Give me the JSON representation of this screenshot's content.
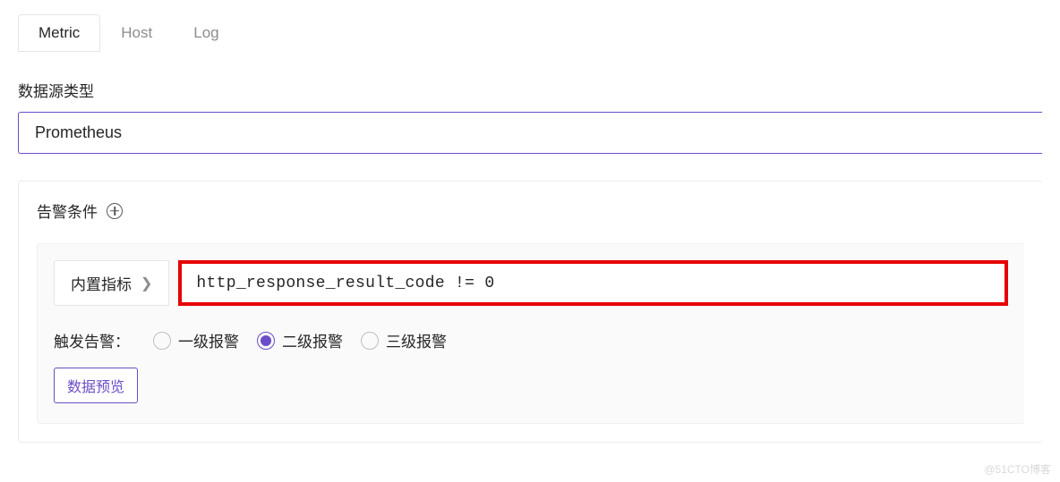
{
  "tabs": {
    "metric": "Metric",
    "host": "Host",
    "log": "Log"
  },
  "datasource": {
    "label": "数据源类型",
    "value": "Prometheus"
  },
  "alertCondition": {
    "title": "告警条件",
    "builtinMetric": {
      "label": "内置指标"
    },
    "expression": "http_response_result_code != 0",
    "trigger": {
      "label": "触发告警",
      "colon": "：",
      "options": [
        "一级报警",
        "二级报警",
        "三级报警"
      ],
      "selected": 1
    },
    "previewButton": "数据预览"
  },
  "watermark": "@51CTO博客"
}
